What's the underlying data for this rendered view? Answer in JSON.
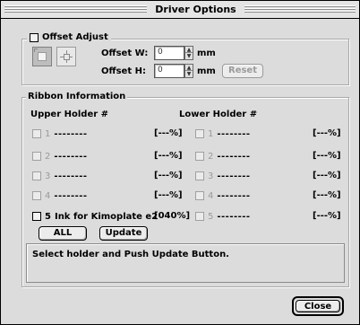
{
  "window": {
    "title": "Driver Options"
  },
  "offset": {
    "checkbox_label": "Offset Adjust",
    "w_label": "Offset W:",
    "w_value": "0",
    "h_label": "Offset H:",
    "h_value": "0",
    "unit": "mm",
    "reset_label": "Reset"
  },
  "ribbon": {
    "group_label": "Ribbon Information",
    "upper_label": "Upper Holder #",
    "lower_label": "Lower Holder #",
    "upper": [
      {
        "num": "1",
        "name": "--------",
        "pct": "[---%]"
      },
      {
        "num": "2",
        "name": "--------",
        "pct": "[---%]"
      },
      {
        "num": "3",
        "name": "--------",
        "pct": "[---%]"
      },
      {
        "num": "4",
        "name": "--------",
        "pct": "[---%]"
      },
      {
        "num": "5",
        "name": "Ink for Kimoplate e2",
        "pct": "[040%]"
      }
    ],
    "lower": [
      {
        "num": "1",
        "name": "--------",
        "pct": "[---%]"
      },
      {
        "num": "2",
        "name": "--------",
        "pct": "[---%]"
      },
      {
        "num": "3",
        "name": "--------",
        "pct": "[---%]"
      },
      {
        "num": "4",
        "name": "--------",
        "pct": "[---%]"
      },
      {
        "num": "5",
        "name": "--------",
        "pct": "[---%]"
      }
    ],
    "all_label": "ALL",
    "update_label": "Update",
    "message": "Select holder and Push Update Button."
  },
  "footer": {
    "close_label": "Close"
  }
}
